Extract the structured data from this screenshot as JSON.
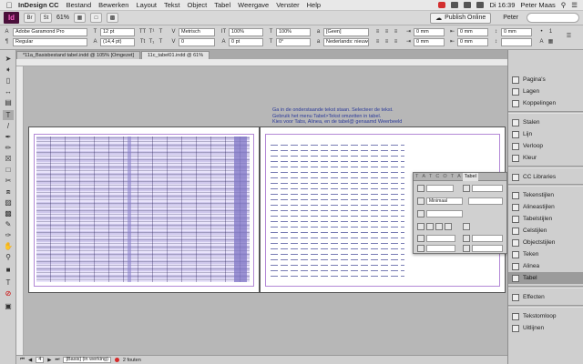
{
  "menubar": {
    "app": "InDesign CC",
    "items": [
      "Bestand",
      "Bewerken",
      "Layout",
      "Tekst",
      "Object",
      "Tabel",
      "Weergave",
      "Venster",
      "Help"
    ],
    "clock": "Di 16:39",
    "user": "Peter Maas"
  },
  "appbar": {
    "logo": "Id",
    "zoom": "61%",
    "publish_label": "Publish Online",
    "user_label": "Peter"
  },
  "control": {
    "font": "Adobe Garamond Pro",
    "style": "Regular",
    "size": "12 pt",
    "leading": "(14,4 pt)",
    "kerning": "Metrisch",
    "tracking": "0",
    "scale_v": "100%",
    "scale_h": "100%",
    "baseline": "0 pt",
    "skew": "0°",
    "language": "Nederlands: nieuwe spell...",
    "char_style": "[Geen]",
    "margin1": "0 mm",
    "margin2": "0 mm",
    "margin3": "0 mm",
    "margin4": "0 mm",
    "margin5": "0 mm"
  },
  "tabs": [
    "*11a_Basisbestand tabel.indd @ 105% [Omgezet]",
    "11c_tabel01.indd @ 61%"
  ],
  "document": {
    "note_lines": [
      "Ga in de onderstaande tekst staan. Selecteer de tekst.",
      "Gebruik het menu Tabel>Tekst omzetten in tabel.",
      "Kies voor Tabs, Alinea, en de tabel@ genaamd Weerbeeld"
    ]
  },
  "statusbar": {
    "page": "4",
    "master": "[Basis] (in werking)",
    "errors": "2 fouten"
  },
  "panels": {
    "items": [
      {
        "label": "Pagina's",
        "icon": "pages-icon"
      },
      {
        "label": "Lagen",
        "icon": "layers-icon"
      },
      {
        "label": "Koppelingen",
        "icon": "links-icon"
      },
      {
        "label": "Stalen",
        "icon": "swatches-icon"
      },
      {
        "label": "Lijn",
        "icon": "stroke-icon"
      },
      {
        "label": "Verloop",
        "icon": "gradient-icon"
      },
      {
        "label": "Kleur",
        "icon": "color-icon"
      },
      {
        "label": "CC Libraries",
        "icon": "cc-libraries-icon"
      },
      {
        "label": "Tekenstijlen",
        "icon": "character-styles-icon"
      },
      {
        "label": "Alineastijlen",
        "icon": "paragraph-styles-icon"
      },
      {
        "label": "Tabelstijlen",
        "icon": "table-styles-icon"
      },
      {
        "label": "Celstijlen",
        "icon": "cell-styles-icon"
      },
      {
        "label": "Objectstijlen",
        "icon": "object-styles-icon"
      },
      {
        "label": "Teken",
        "icon": "character-icon"
      },
      {
        "label": "Alinea",
        "icon": "paragraph-icon"
      },
      {
        "label": "Tabel",
        "icon": "table-icon"
      },
      {
        "label": "Effecten",
        "icon": "effects-icon"
      },
      {
        "label": "Tekstomloop",
        "icon": "text-wrap-icon"
      },
      {
        "label": "Uitlijnen",
        "icon": "align-icon"
      }
    ],
    "selected": "Tabel"
  },
  "floatpanel": {
    "tabs": [
      "T",
      "A",
      "T",
      "C",
      "O",
      "T",
      "A",
      "Tabel"
    ],
    "active_tab": "Tabel",
    "row_height_mode": "Minimaal",
    "value_a": "",
    "value_b": ""
  }
}
